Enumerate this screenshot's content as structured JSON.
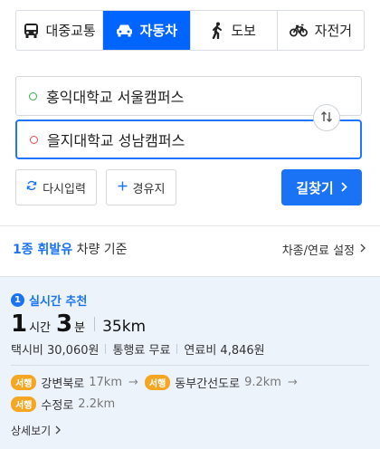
{
  "modes": [
    {
      "label": "대중교통",
      "icon": "bus-icon"
    },
    {
      "label": "자동차",
      "icon": "car-icon",
      "active": true
    },
    {
      "label": "도보",
      "icon": "walk-icon"
    },
    {
      "label": "자전거",
      "icon": "bike-icon"
    }
  ],
  "route": {
    "origin": "홍익대학교 서울캠퍼스",
    "destination": "을지대학교 성남캠퍼스"
  },
  "actions": {
    "reset": "다시입력",
    "waypoint": "경유지",
    "search": "길찾기"
  },
  "vehicle": {
    "highlight": "1종 휘발유",
    "suffix": " 차량 기준",
    "settings": "차종/연료 설정"
  },
  "result": {
    "rank": "1",
    "label": "실시간 추천",
    "hours": "1",
    "hours_unit": "시간",
    "minutes": "3",
    "minutes_unit": "분",
    "distance": "35km",
    "taxi": "택시비 30,060원",
    "toll": "통행료 무료",
    "fuel": "연료비 4,846원",
    "roads": [
      {
        "badge": "서행",
        "name": "강변북로",
        "dist": "17km"
      },
      {
        "badge": "서행",
        "name": "동부간선도로",
        "dist": "9.2km"
      },
      {
        "badge": "서행",
        "name": "수정로",
        "dist": "2.2km"
      }
    ],
    "detail": "상세보기"
  },
  "colors": {
    "accent": "#1a73f5",
    "badge": "#f5a623",
    "card_bg": "#edf3fb"
  }
}
